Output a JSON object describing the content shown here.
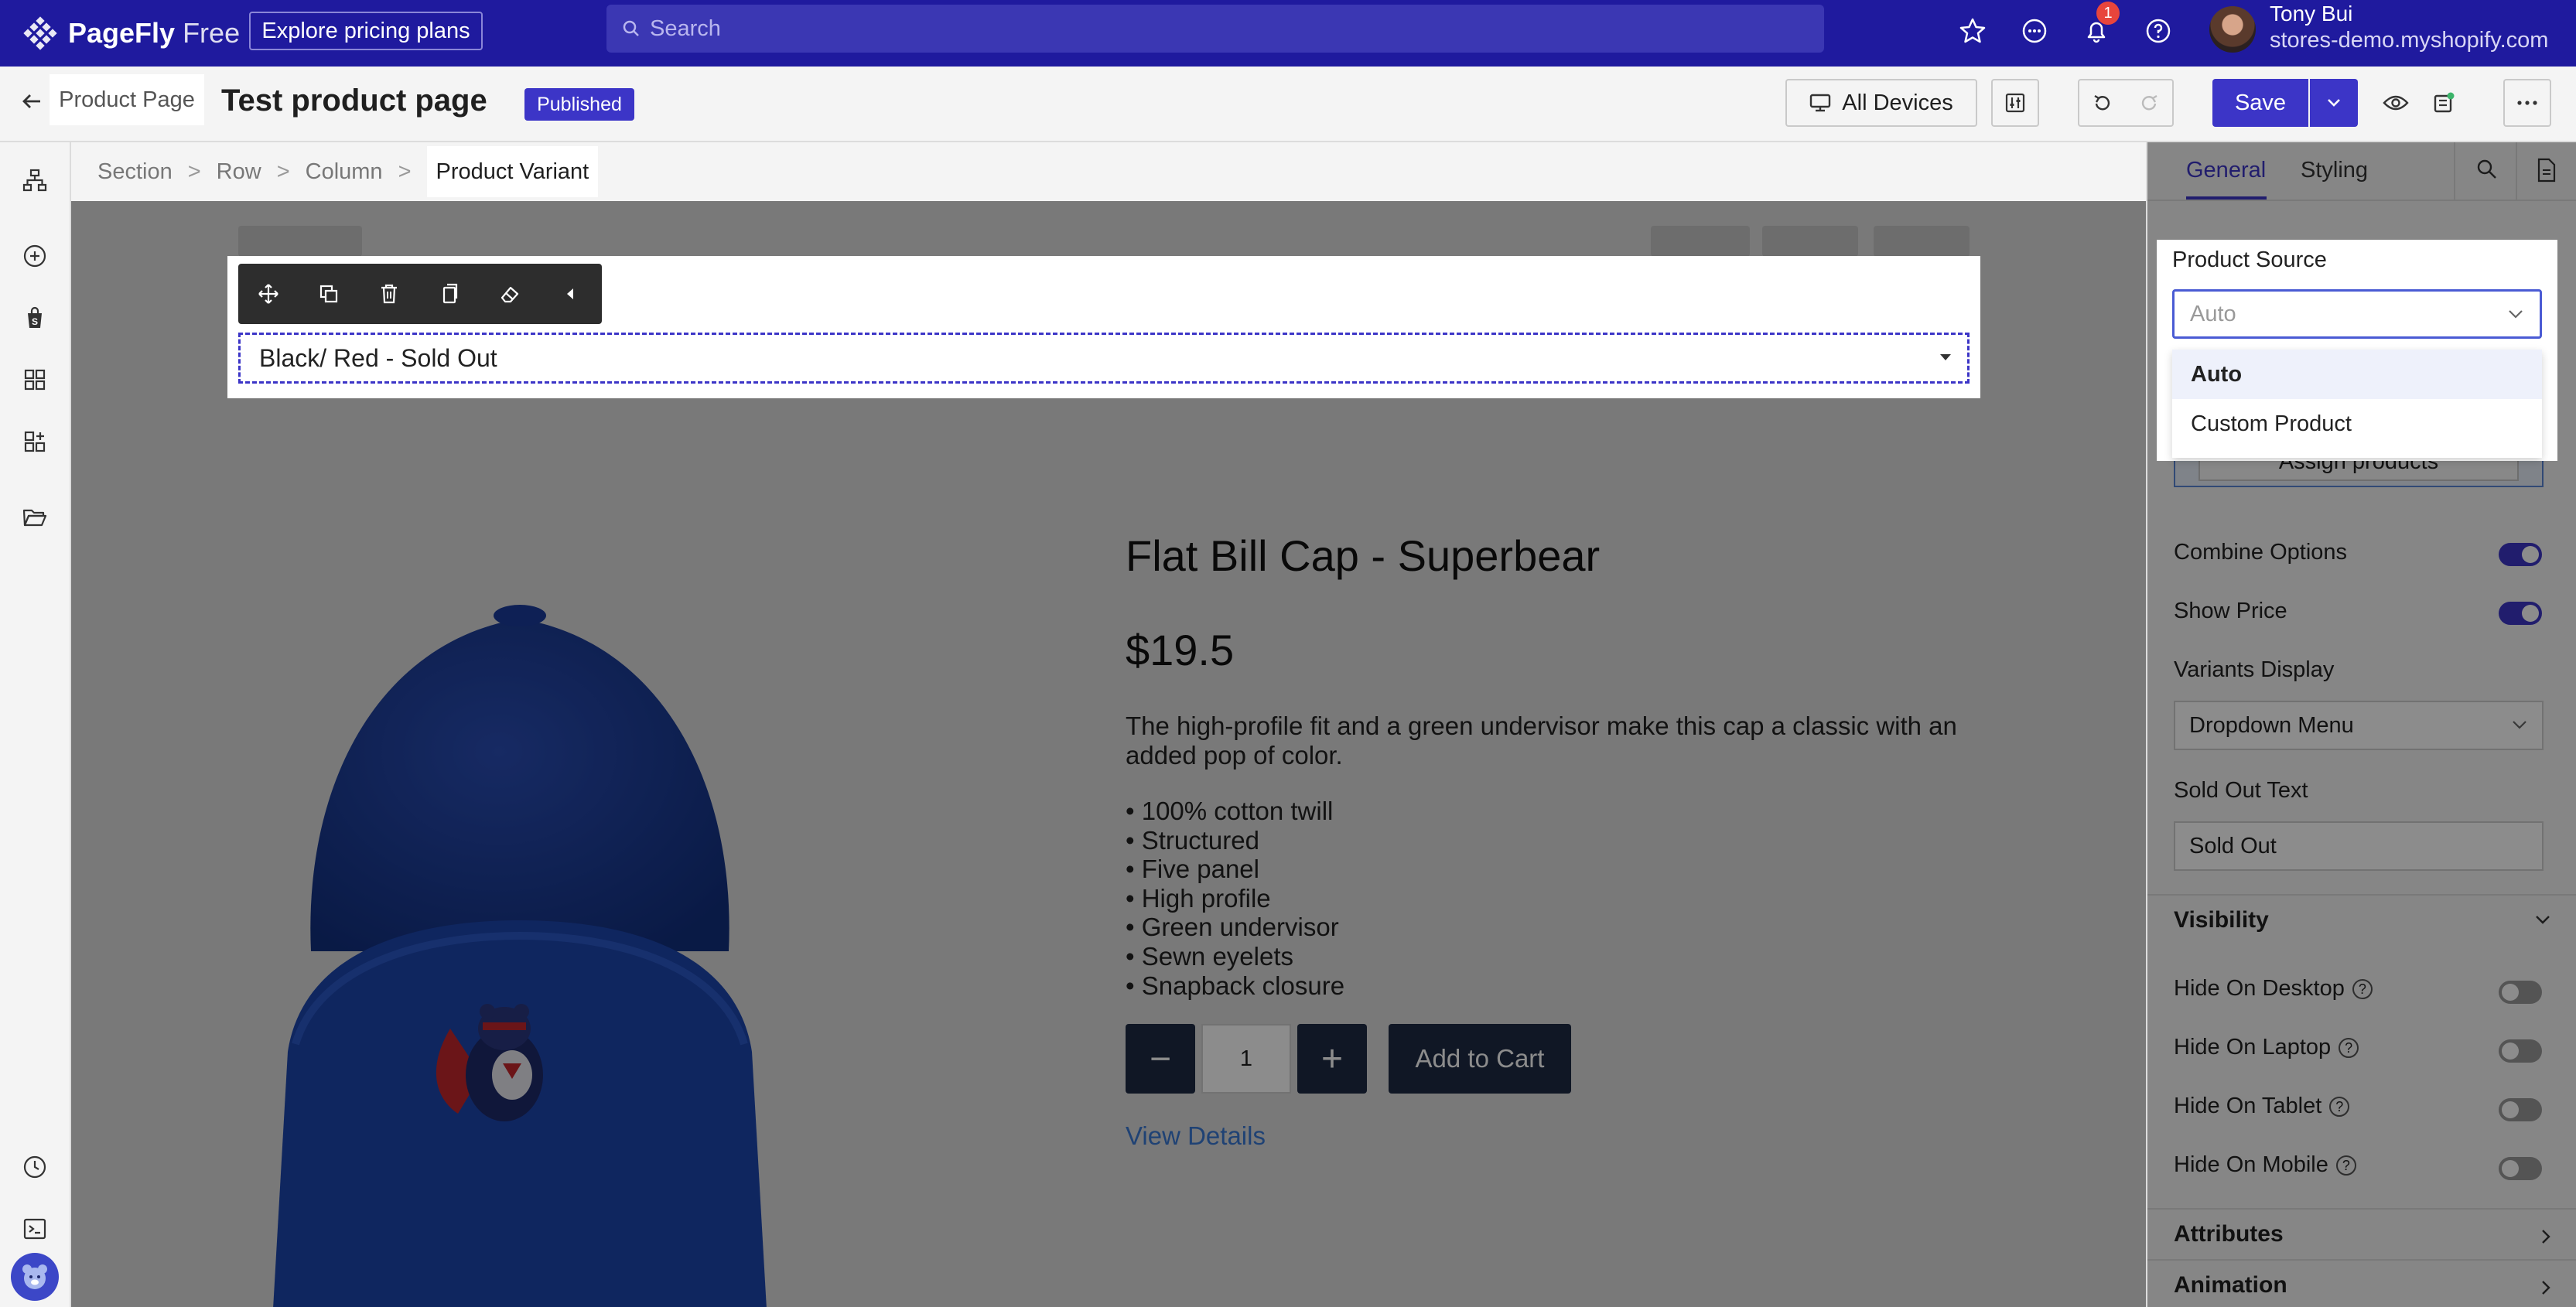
{
  "topbar": {
    "brand_name": "PageFly",
    "brand_plan": "Free",
    "pricing_label": "Explore pricing plans",
    "search_placeholder": "Search",
    "notification_count": "1",
    "user_name": "Tony Bui",
    "user_store": "stores-demo.myshopify.com",
    "icons": [
      "star-icon",
      "chat-icon",
      "bell-icon",
      "help-icon"
    ]
  },
  "header": {
    "page_type": "Product Page",
    "page_title": "Test product page",
    "status": "Published",
    "device_label": "All Devices",
    "save_label": "Save"
  },
  "breadcrumb": [
    "Section",
    "Row",
    "Column",
    "Product Variant"
  ],
  "canvas": {
    "variant_value": "Black/ Red - Sold Out",
    "product": {
      "title": "Flat Bill Cap - Superbear",
      "price": "$19.5",
      "description": "The high-profile fit and a green undervisor make this cap a classic with an added pop of color.",
      "bullets": [
        "• 100% cotton twill",
        "• Structured",
        "• Five panel",
        "• High profile",
        "• Green undervisor",
        "• Sewn eyelets",
        "• Snapback closure"
      ],
      "quantity": "1",
      "minus": "−",
      "plus": "+",
      "add_to_cart": "Add to Cart",
      "view_details": "View Details"
    }
  },
  "panel": {
    "tabs": [
      "General",
      "Styling"
    ],
    "product_source_label": "Product Source",
    "product_source_placeholder": "Auto",
    "product_source_options": [
      "Auto",
      "Custom Product"
    ],
    "assign_label": "Assign products",
    "combine_options": {
      "label": "Combine Options",
      "on": true
    },
    "show_price": {
      "label": "Show Price",
      "on": true
    },
    "variants_display_label": "Variants Display",
    "variants_display_value": "Dropdown Menu",
    "sold_out_label": "Sold Out Text",
    "sold_out_value": "Sold Out",
    "visibility_label": "Visibility",
    "hide_desktop": "Hide On Desktop",
    "hide_laptop": "Hide On Laptop",
    "hide_tablet": "Hide On Tablet",
    "hide_mobile": "Hide On Mobile",
    "attributes_label": "Attributes",
    "animation_label": "Animation"
  },
  "colors": {
    "topbar": "#1f1a9e",
    "accent": "#3c35c7",
    "product_button": "#1e2a44",
    "cap": "#0f2a78"
  }
}
